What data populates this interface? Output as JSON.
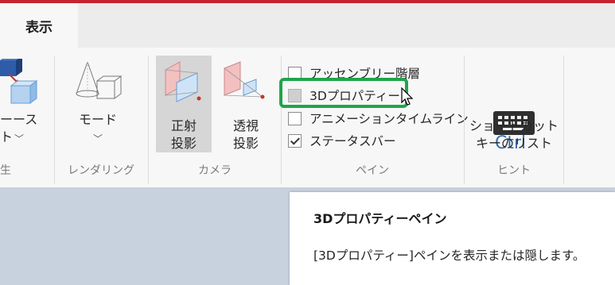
{
  "tabs": [
    {
      "label": "表示",
      "active": true
    }
  ],
  "ribbon": {
    "groups": {
      "visibility": {
        "button_label_fragment": "ーースト",
        "label_fragment": "生"
      },
      "rendering": {
        "label": "レンダリング",
        "mode_button": "モード"
      },
      "camera": {
        "label": "カメラ",
        "ortho_line1": "正射",
        "ortho_line2": "投影",
        "persp_line1": "透視",
        "persp_line2": "投影"
      },
      "panes": {
        "label": "ペイン",
        "items": [
          {
            "label": "アッセンブリー階層",
            "checked": false,
            "disabled": false
          },
          {
            "label": "3Dプロパティー",
            "checked": false,
            "disabled": true
          },
          {
            "label": "アニメーションタイムライン",
            "checked": false,
            "disabled": false
          },
          {
            "label": "ステータスバー",
            "checked": true,
            "disabled": false
          }
        ]
      },
      "hints": {
        "label": "ヒント",
        "shortcut_line1": "ショートカット",
        "shortcut_line2": "キーのリスト",
        "ctrl_text": "Ctrl"
      }
    }
  },
  "tooltip": {
    "title": "3Dプロパティーペイン",
    "body": "[3Dプロパティー]ペインを表示または隠します。"
  },
  "colors": {
    "accent_bar": "#c4262e",
    "highlight": "#1fa54a",
    "ctrl_blue": "#3b6fb5"
  }
}
